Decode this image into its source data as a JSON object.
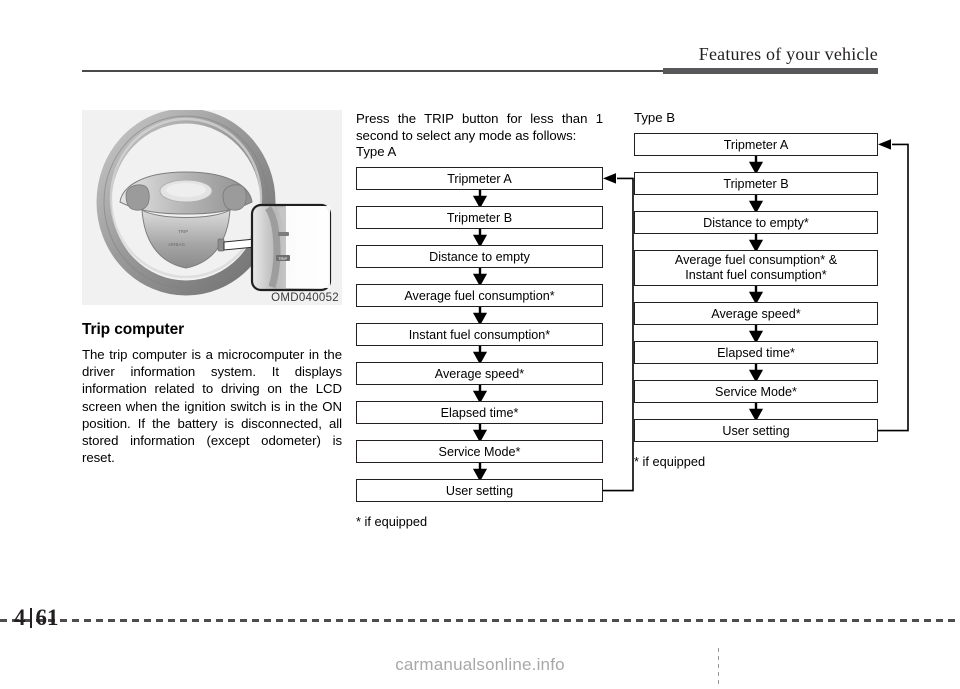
{
  "header": {
    "title": "Features of your vehicle"
  },
  "footer": {
    "chapter": "4",
    "page": "61",
    "watermark": "carmanualsonline.info"
  },
  "figure": {
    "caption": "OMD040052",
    "alt_name": "steering-wheel-trip-button-illustration"
  },
  "left_column": {
    "section_title": "Trip computer",
    "body": "The trip computer is a microcomputer in the driver information system. It displays information related to driving on the LCD screen when the ignition switch is in the ON position. If the battery is disconnected, all stored information (except odometer) is reset."
  },
  "middle_column": {
    "intro": "Press the TRIP button for less than 1 second to select any mode as follows:",
    "type_label": "Type A",
    "footnote": "* if equipped",
    "flow_steps": [
      "Tripmeter A",
      "Tripmeter B",
      "Distance to empty",
      "Average fuel consumption*",
      "Instant fuel consumption*",
      "Average speed*",
      "Elapsed time*",
      "Service Mode*",
      "User setting"
    ]
  },
  "right_column": {
    "type_label": "Type B",
    "footnote": "* if equipped",
    "flow_steps": [
      "Tripmeter A",
      "Tripmeter B",
      "Distance to empty*",
      "Average fuel consumption* &\nInstant fuel consumption*",
      "Average speed*",
      "Elapsed time*",
      "Service Mode*",
      "User setting"
    ]
  },
  "colors": {
    "rule": "#4a4a4a",
    "rule_thick": "#58585a",
    "box_border": "#231f20",
    "figure_bg": "#f1f1f1",
    "watermark": "#a8a8a8"
  }
}
